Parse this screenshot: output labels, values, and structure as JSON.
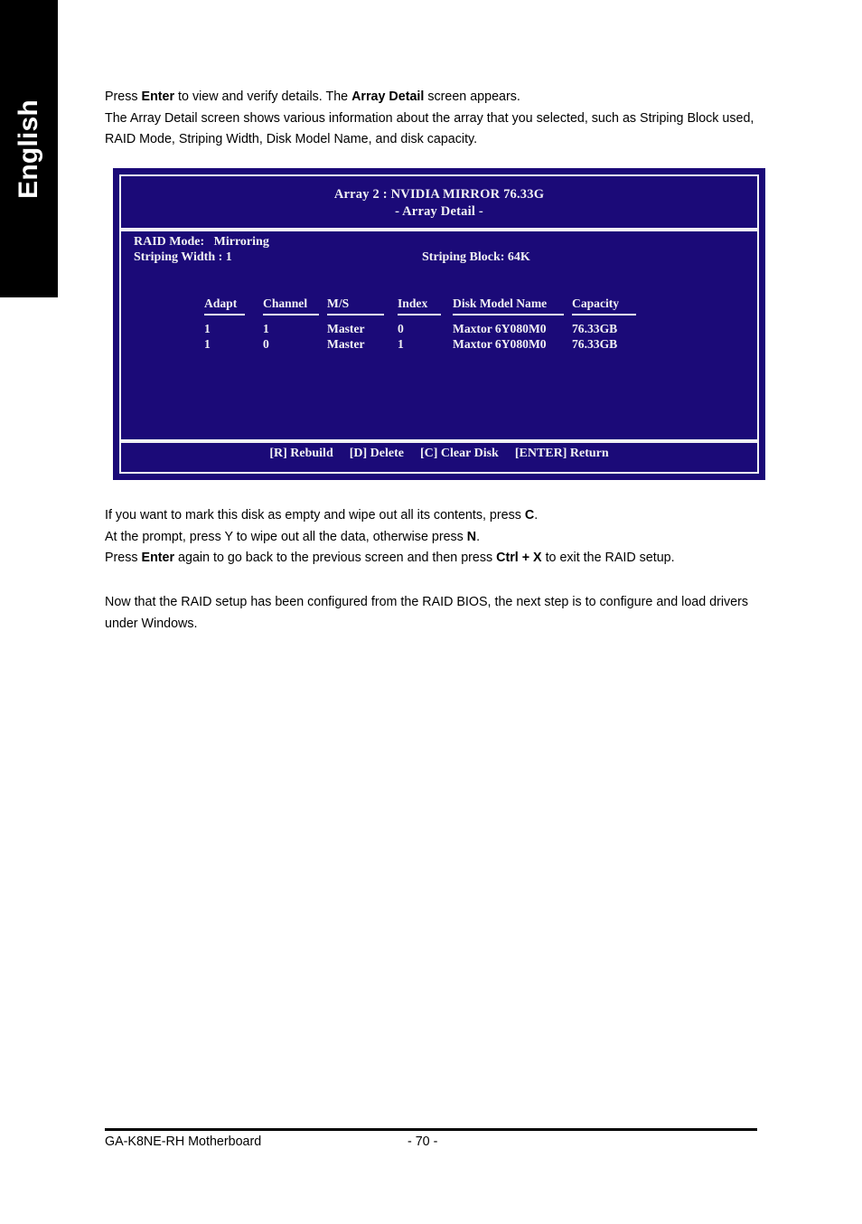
{
  "language_tab": {
    "label": "English"
  },
  "intro": {
    "lines": [
      {
        "segments": [
          {
            "text": "Press ",
            "bold": false
          },
          {
            "text": "Enter",
            "bold": true
          },
          {
            "text": " to view and verify details. The ",
            "bold": false
          },
          {
            "text": "Array Detail",
            "bold": true
          },
          {
            "text": " screen appears.",
            "bold": false
          }
        ]
      },
      {
        "segments": [
          {
            "text": "The Array Detail screen shows various information about the array that you selected, such as Striping Block used, RAID Mode, Striping Width, Disk Model Name, and disk capacity.",
            "bold": false
          }
        ]
      }
    ]
  },
  "bios_screen": {
    "title_line_1": "Array 2 : NVIDIA MIRROR 76.33G",
    "title_line_2": "- Array Detail -",
    "info": {
      "raid_mode_label": "RAID Mode:",
      "raid_mode_value": "Mirroring",
      "striping_width_label": "Striping Width : 1",
      "striping_block_label": "Striping Block: 64K"
    },
    "table": {
      "headers": [
        "Adapt",
        "Channel",
        "M/S",
        "Index",
        "Disk Model Name",
        "Capacity"
      ],
      "rows": [
        [
          "1",
          "1",
          "Master",
          "0",
          "Maxtor 6Y080M0",
          "76.33GB"
        ],
        [
          "1",
          "0",
          "Master",
          "1",
          "Maxtor 6Y080M0",
          "76.33GB"
        ]
      ]
    },
    "footer_keys": [
      "[R] Rebuild",
      "[D] Delete",
      "[C] Clear Disk",
      "[ENTER] Return"
    ],
    "colors": {
      "background": "#1b0a78",
      "text": "#f2f2f4"
    }
  },
  "lower_text_1": {
    "lines": [
      {
        "segments": [
          {
            "text": "If you want to mark this disk as empty and wipe out all its contents, press ",
            "bold": false
          },
          {
            "text": "C",
            "bold": true
          },
          {
            "text": ".",
            "bold": false
          }
        ]
      },
      {
        "segments": [
          {
            "text": "At the prompt, press Y to wipe out all the data, otherwise press ",
            "bold": false
          },
          {
            "text": "N",
            "bold": true
          },
          {
            "text": ".",
            "bold": false
          }
        ]
      },
      {
        "segments": [
          {
            "text": "Press ",
            "bold": false
          },
          {
            "text": "Enter",
            "bold": true
          },
          {
            "text": " again to go back to the previous screen and then press ",
            "bold": false
          },
          {
            "text": "Ctrl + X",
            "bold": true
          },
          {
            "text": " to exit the RAID setup.",
            "bold": false
          }
        ]
      }
    ]
  },
  "lower_text_2": {
    "lines": [
      {
        "segments": [
          {
            "text": "Now that the RAID setup has been configured from the RAID BIOS, the next step is to configure and load drivers under Windows.",
            "bold": false
          }
        ]
      }
    ]
  },
  "page_footer": {
    "product": "GA-K8NE-RH Motherboard",
    "page_number": "- 70 -"
  }
}
